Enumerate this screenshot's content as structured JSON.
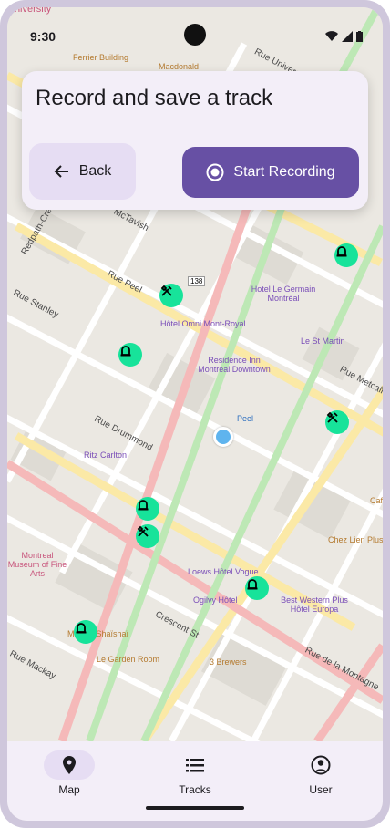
{
  "status_bar": {
    "time": "9:30"
  },
  "card": {
    "title": "Record and save a track",
    "back_label": "Back",
    "record_label": "Start Recording"
  },
  "map": {
    "top_labels": {
      "university": "University",
      "ferrier": "Ferrier Building",
      "macdonald": "Macdonald",
      "rue_univ": "Rue University"
    },
    "streets": {
      "mctavish": "McTavish",
      "peel": "Rue Peel",
      "stanley": "Rue Stanley",
      "drummond": "Rue Drummond",
      "metcalfe": "Rue Metcalfe",
      "crescent": "Crescent St",
      "mackay": "Rue Mackay",
      "montagne": "Rue de la Montagne",
      "redpath": "Redpath-Crescent"
    },
    "road_shield": "138",
    "pois": {
      "omni": "Hôtel Omni Mont-Royal",
      "legermain": "Hotel Le Germain Montréal",
      "residence": "Residence Inn Montreal Downtown",
      "stmartin": "Le St Martin",
      "peel_metro": "Peel",
      "ritz": "Ritz Carlton",
      "museum": "Montreal Museum of Fine Arts",
      "loews": "Loews Hôtel Vogue",
      "ogilvy": "Ogilvy Hôtel",
      "bestwestern": "Best Western Plus Hôtel Europa",
      "chezlien": "Chez Lien Plus",
      "cafe": "Caf",
      "maiss": "Maison Shaïshaï",
      "garden": "Le Garden Room",
      "brewers": "3 Brewers"
    }
  },
  "nav": {
    "items": [
      {
        "label": "Map",
        "icon": "map-pin-icon",
        "active": true
      },
      {
        "label": "Tracks",
        "icon": "list-icon",
        "active": false
      },
      {
        "label": "User",
        "icon": "account-circle-icon",
        "active": false
      }
    ]
  },
  "colors": {
    "primary": "#6750a4",
    "marker": "#17e39a",
    "location": "#5fb4ee"
  }
}
